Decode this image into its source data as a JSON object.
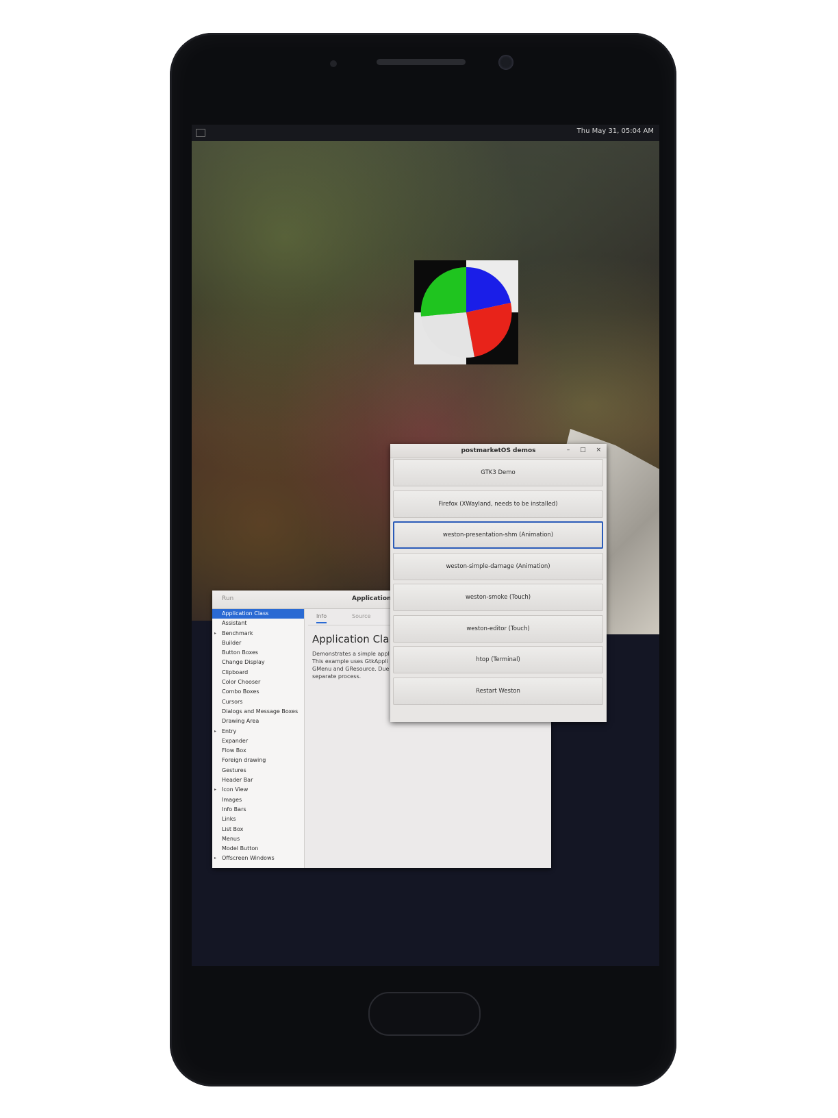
{
  "status_bar": {
    "clock": "Thu May 31, 05:04 AM"
  },
  "pie_widget": {
    "colors": {
      "green": "#1fc41f",
      "blue": "#1a1ee8",
      "red": "#e8231a"
    }
  },
  "gtk_demo": {
    "run_label": "Run",
    "title": "Application",
    "sidebar": {
      "items": [
        {
          "label": "Application Class",
          "selected": true,
          "expandable": false
        },
        {
          "label": "Assistant",
          "expandable": false
        },
        {
          "label": "Benchmark",
          "expandable": true
        },
        {
          "label": "Builder",
          "expandable": false
        },
        {
          "label": "Button Boxes",
          "expandable": false
        },
        {
          "label": "Change Display",
          "expandable": false
        },
        {
          "label": "Clipboard",
          "expandable": false
        },
        {
          "label": "Color Chooser",
          "expandable": false
        },
        {
          "label": "Combo Boxes",
          "expandable": false
        },
        {
          "label": "Cursors",
          "expandable": false
        },
        {
          "label": "Dialogs and Message Boxes",
          "expandable": false
        },
        {
          "label": "Drawing Area",
          "expandable": false
        },
        {
          "label": "Entry",
          "expandable": true
        },
        {
          "label": "Expander",
          "expandable": false
        },
        {
          "label": "Flow Box",
          "expandable": false
        },
        {
          "label": "Foreign drawing",
          "expandable": false
        },
        {
          "label": "Gestures",
          "expandable": false
        },
        {
          "label": "Header Bar",
          "expandable": false
        },
        {
          "label": "Icon View",
          "expandable": true
        },
        {
          "label": "Images",
          "expandable": false
        },
        {
          "label": "Info Bars",
          "expandable": false
        },
        {
          "label": "Links",
          "expandable": false
        },
        {
          "label": "List Box",
          "expandable": false
        },
        {
          "label": "Menus",
          "expandable": false
        },
        {
          "label": "Model Button",
          "expandable": false
        },
        {
          "label": "Offscreen Windows",
          "expandable": true
        }
      ]
    },
    "tabs": [
      {
        "label": "Info",
        "active": true
      },
      {
        "label": "Source",
        "active": false
      }
    ],
    "content": {
      "heading": "Application Cla",
      "lines": [
        "Demonstrates a simple appl",
        "This example uses GtkAppli",
        "GMenu and GResource. Due",
        "separate process."
      ]
    }
  },
  "pm_demos": {
    "title": "postmarketOS demos",
    "controls": {
      "minimize": "–",
      "maximize": "□",
      "close": "×"
    },
    "buttons": [
      {
        "label": "GTK3 Demo",
        "focused": false
      },
      {
        "label": "Firefox (XWayland, needs to be installed)",
        "focused": false
      },
      {
        "label": "weston-presentation-shm (Animation)",
        "focused": true
      },
      {
        "label": "weston-simple-damage (Animation)",
        "focused": false
      },
      {
        "label": "weston-smoke (Touch)",
        "focused": false
      },
      {
        "label": "weston-editor (Touch)",
        "focused": false
      },
      {
        "label": "htop (Terminal)",
        "focused": false
      },
      {
        "label": "Restart Weston",
        "focused": false
      }
    ]
  }
}
